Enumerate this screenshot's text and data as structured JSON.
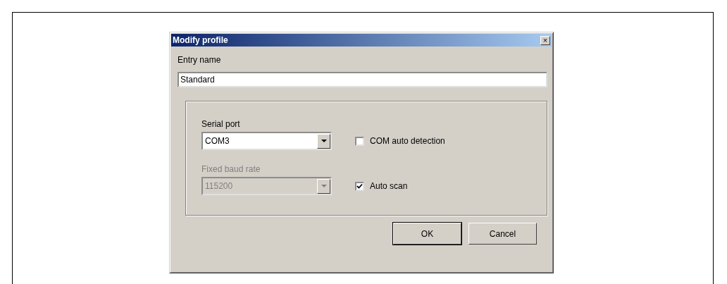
{
  "window": {
    "title": "Modify profile",
    "close": "×"
  },
  "entry": {
    "label": "Entry name",
    "value": "Standard"
  },
  "selects": [
    {
      "label": "Serial port",
      "value": "COM3",
      "disabled": false
    },
    {
      "label": "Fixed baud rate",
      "value": "115200",
      "disabled": true
    }
  ],
  "checkboxes": [
    {
      "label": "COM auto detection",
      "checked": false
    },
    {
      "label": "Auto scan",
      "checked": true
    }
  ],
  "buttons": [
    {
      "label": "OK",
      "default": true
    },
    {
      "label": "Cancel",
      "default": false
    }
  ]
}
